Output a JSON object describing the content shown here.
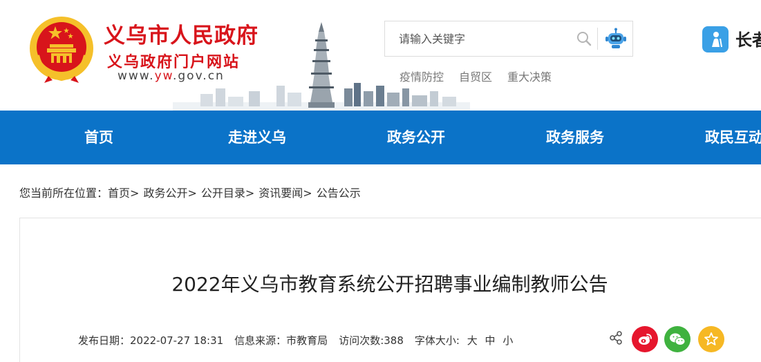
{
  "header": {
    "brand_title": "义乌市人民政府",
    "brand_subtitle": "义乌政府门户网站",
    "brand_url_prefix": "www.",
    "brand_url_accent": "yw",
    "brand_url_suffix": ".gov.cn",
    "search": {
      "placeholder": "请输入关键字",
      "value": ""
    },
    "quick_links": [
      "疫情防控",
      "自贸区",
      "重大决策"
    ],
    "elder_mode_label": "长者"
  },
  "nav": {
    "items": [
      "首页",
      "走进义乌",
      "政务公开",
      "政务服务",
      "政民互动"
    ]
  },
  "breadcrumb": {
    "prefix": "您当前所在位置：",
    "items": [
      "首页",
      "政务公开",
      "公开目录",
      "资讯要闻",
      "公告公示"
    ],
    "separator": ">"
  },
  "article": {
    "title": "2022年义乌市教育系统公开招聘事业编制教师公告",
    "meta": {
      "date_label": "发布日期：2022-07-27 18:31",
      "source_label": "信息来源：市教育局",
      "visits_label": "访问次数:388",
      "font_size_label": "字体大小:",
      "size_large": "大",
      "size_medium": "中",
      "size_small": "小"
    }
  },
  "icons": {
    "share": "share-icon",
    "weibo": "weibo-icon",
    "wechat": "wechat-icon",
    "favorite": "favorite-icon"
  },
  "colors": {
    "brand_red": "#d8141b",
    "nav_blue": "#0b73c8",
    "weibo_red": "#e6162d",
    "wechat_green": "#3fb23f",
    "favorite_yellow": "#f6b824"
  }
}
